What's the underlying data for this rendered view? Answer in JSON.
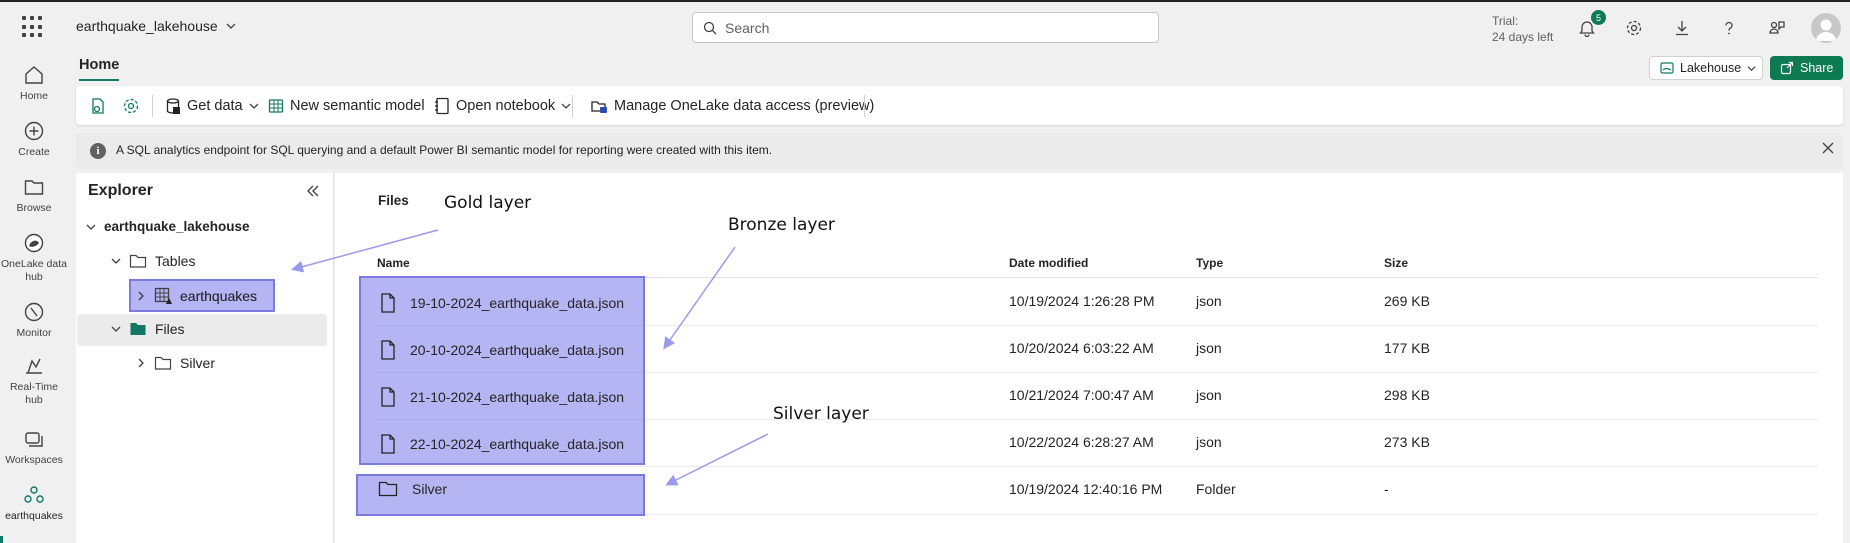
{
  "header": {
    "workspace_title": "earthquake_lakehouse",
    "search_placeholder": "Search",
    "trial_line1": "Trial:",
    "trial_line2": "24 days left",
    "notification_count": "5"
  },
  "nav": {
    "items": [
      {
        "label": "Home",
        "icon": "home-icon"
      },
      {
        "label": "Create",
        "icon": "plus-circle-icon"
      },
      {
        "label": "Browse",
        "icon": "folder-icon"
      },
      {
        "label": "OneLake data hub",
        "icon": "onelake-icon"
      },
      {
        "label": "Monitor",
        "icon": "monitor-icon"
      },
      {
        "label": "Real-Time hub",
        "icon": "realtime-icon"
      },
      {
        "label": "Workspaces",
        "icon": "workspaces-icon"
      },
      {
        "label": "earthquakes",
        "icon": "earthquakes-workspace-icon"
      }
    ]
  },
  "ribbon": {
    "home_tab": "Home",
    "get_data": "Get data",
    "new_semantic_model": "New semantic model",
    "open_notebook": "Open notebook",
    "manage_access": "Manage OneLake data access (preview)",
    "lakehouse_switch": "Lakehouse",
    "share": "Share"
  },
  "banner": {
    "message": "A SQL analytics endpoint for SQL querying and a default Power BI semantic model for reporting were created with this item."
  },
  "explorer": {
    "title": "Explorer",
    "root": "earthquake_lakehouse",
    "tables": "Tables",
    "table_item": "earthquakes",
    "files": "Files",
    "files_child": "Silver"
  },
  "content": {
    "breadcrumb": "Files",
    "columns": {
      "name": "Name",
      "date": "Date modified",
      "type": "Type",
      "size": "Size"
    },
    "rows": [
      {
        "name": "19-10-2024_earthquake_data.json",
        "date": "10/19/2024 1:26:28 PM",
        "type": "json",
        "size": "269 KB",
        "icon": "file-icon"
      },
      {
        "name": "20-10-2024_earthquake_data.json",
        "date": "10/20/2024 6:03:22 AM",
        "type": "json",
        "size": "177 KB",
        "icon": "file-icon"
      },
      {
        "name": "21-10-2024_earthquake_data.json",
        "date": "10/21/2024 7:00:47 AM",
        "type": "json",
        "size": "298 KB",
        "icon": "file-icon"
      },
      {
        "name": "22-10-2024_earthquake_data.json",
        "date": "10/22/2024 6:28:27 AM",
        "type": "json",
        "size": "273 KB",
        "icon": "file-icon"
      },
      {
        "name": "Silver",
        "date": "10/19/2024 12:40:16 PM",
        "type": "Folder",
        "size": "-",
        "icon": "folder-icon"
      }
    ]
  },
  "annotations": {
    "gold": "Gold layer",
    "bronze": "Bronze layer",
    "silver": "Silver layer",
    "highlight_color": "#7b7bdf"
  },
  "colors": {
    "accent": "#117865",
    "share_button": "#0e7a54"
  }
}
